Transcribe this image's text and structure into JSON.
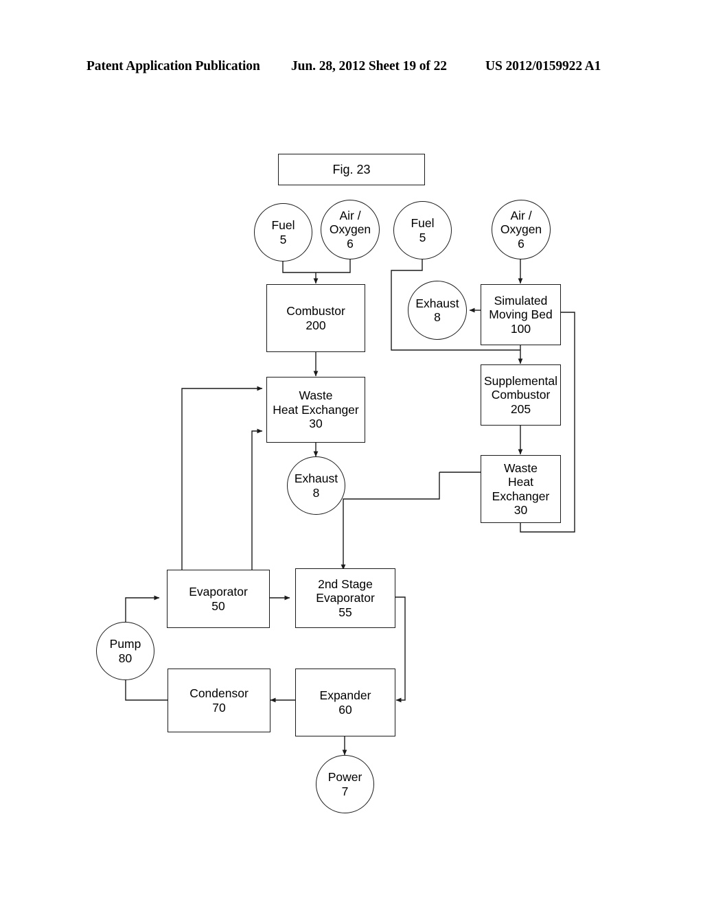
{
  "header": {
    "left": "Patent Application Publication",
    "middle": "Jun. 28, 2012  Sheet 19 of 22",
    "right": "US 2012/0159922 A1"
  },
  "figure": {
    "title": "Fig. 23"
  },
  "diagram": {
    "type": "process-flow-diagram",
    "nodes": [
      {
        "id": "fuel-1",
        "shape": "circle",
        "label": "Fuel",
        "number": "5"
      },
      {
        "id": "air-1",
        "shape": "circle",
        "label": "Air /\nOxygen",
        "number": "6"
      },
      {
        "id": "fuel-2",
        "shape": "circle",
        "label": "Fuel",
        "number": "5"
      },
      {
        "id": "air-2",
        "shape": "circle",
        "label": "Air /\nOxygen",
        "number": "6"
      },
      {
        "id": "combustor",
        "shape": "box",
        "label": "Combustor",
        "number": "200"
      },
      {
        "id": "exhaust-1",
        "shape": "circle",
        "label": "Exhaust",
        "number": "8"
      },
      {
        "id": "smb",
        "shape": "box",
        "label": "Simulated\nMoving Bed",
        "number": "100"
      },
      {
        "id": "whe-1",
        "shape": "box",
        "label": "Waste\nHeat Exchanger",
        "number": "30"
      },
      {
        "id": "supp-comb",
        "shape": "box",
        "label": "Supplemental\nCombustor",
        "number": "205"
      },
      {
        "id": "whe-2",
        "shape": "box",
        "label": "Waste\nHeat\nExchanger",
        "number": "30"
      },
      {
        "id": "exhaust-2",
        "shape": "circle",
        "label": "Exhaust",
        "number": "8"
      },
      {
        "id": "evap",
        "shape": "box",
        "label": "Evaporator",
        "number": "50"
      },
      {
        "id": "evap2",
        "shape": "box",
        "label": "2nd Stage\nEvaporator",
        "number": "55"
      },
      {
        "id": "pump",
        "shape": "circle",
        "label": "Pump",
        "number": "80"
      },
      {
        "id": "condensor",
        "shape": "box",
        "label": "Condensor",
        "number": "70"
      },
      {
        "id": "expander",
        "shape": "box",
        "label": "Expander",
        "number": "60"
      },
      {
        "id": "power",
        "shape": "circle",
        "label": "Power",
        "number": "7"
      }
    ],
    "connections": [
      {
        "from": "fuel-1",
        "to": "combustor"
      },
      {
        "from": "air-1",
        "to": "combustor"
      },
      {
        "from": "fuel-2",
        "to": "smb"
      },
      {
        "from": "air-2",
        "to": "smb"
      },
      {
        "from": "smb",
        "to": "exhaust-1"
      },
      {
        "from": "smb",
        "to": "supp-comb"
      },
      {
        "from": "combustor",
        "to": "whe-1"
      },
      {
        "from": "evap",
        "to": "whe-1"
      },
      {
        "from": "evap",
        "to": "whe-1"
      },
      {
        "from": "whe-1",
        "to": "exhaust-2"
      },
      {
        "from": "supp-comb",
        "to": "whe-2"
      },
      {
        "from": "whe-2",
        "to": "smb"
      },
      {
        "from": "whe-2",
        "to": "evap2"
      },
      {
        "from": "pump",
        "to": "evap"
      },
      {
        "from": "evap",
        "to": "evap2"
      },
      {
        "from": "evap2",
        "to": "expander"
      },
      {
        "from": "expander",
        "to": "condensor"
      },
      {
        "from": "condensor",
        "to": "pump"
      },
      {
        "from": "expander",
        "to": "power"
      }
    ],
    "colors": {
      "line": "#1a1a1a",
      "background": "#ffffff"
    }
  }
}
